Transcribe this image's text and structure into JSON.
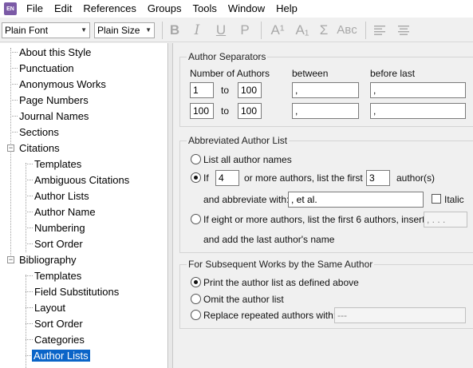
{
  "app": {
    "icon_text": "EN"
  },
  "menu": [
    "File",
    "Edit",
    "References",
    "Groups",
    "Tools",
    "Window",
    "Help"
  ],
  "toolbar": {
    "font_value": "Plain Font",
    "size_value": "Plain Size",
    "bold": "B",
    "italic": "I",
    "underline": "U",
    "plain": "P",
    "superscript": "A¹",
    "subscript": "A₁",
    "symbol": "Σ",
    "small_caps": "Aʙᴄ"
  },
  "tree": {
    "items": [
      {
        "label": "About this Style"
      },
      {
        "label": "Punctuation"
      },
      {
        "label": "Anonymous Works"
      },
      {
        "label": "Page Numbers"
      },
      {
        "label": "Journal Names"
      },
      {
        "label": "Sections"
      },
      {
        "label": "Citations",
        "expander": "−"
      },
      {
        "label": "Templates"
      },
      {
        "label": "Ambiguous Citations"
      },
      {
        "label": "Author Lists"
      },
      {
        "label": "Author Name"
      },
      {
        "label": "Numbering"
      },
      {
        "label": "Sort Order"
      },
      {
        "label": "Bibliography",
        "expander": "−"
      },
      {
        "label": "Templates"
      },
      {
        "label": "Field Substitutions"
      },
      {
        "label": "Layout"
      },
      {
        "label": "Sort Order"
      },
      {
        "label": "Categories"
      },
      {
        "label": "Author Lists"
      }
    ]
  },
  "separators": {
    "title": "Author Separators",
    "number_label": "Number of Authors",
    "between_label": "between",
    "before_last_label": "before last",
    "to_label": "to",
    "rows": [
      {
        "from": "1",
        "to": "100",
        "between": ",",
        "before_last": ","
      },
      {
        "from": "100",
        "to": "100",
        "between": ",",
        "before_last": ","
      }
    ]
  },
  "abbrev": {
    "title": "Abbreviated Author List",
    "list_all": "List all author names",
    "if_label": "If",
    "if_value": "4",
    "or_more": "or more authors, list the first",
    "first_value": "3",
    "authors_suffix": "author(s)",
    "abbrev_with_label": "and abbreviate with:",
    "abbrev_with_value": ", et al.",
    "italic_label": "Italic",
    "eight_label": "If eight or more authors, list the first 6 authors, insert:",
    "eight_value": ", . . .",
    "add_last": "and add the last author's name"
  },
  "subsequent": {
    "title": "For Subsequent Works by the Same Author",
    "print": "Print the author list as defined above",
    "omit": "Omit the author list",
    "replace": "Replace repeated authors with:",
    "replace_value": "---"
  }
}
